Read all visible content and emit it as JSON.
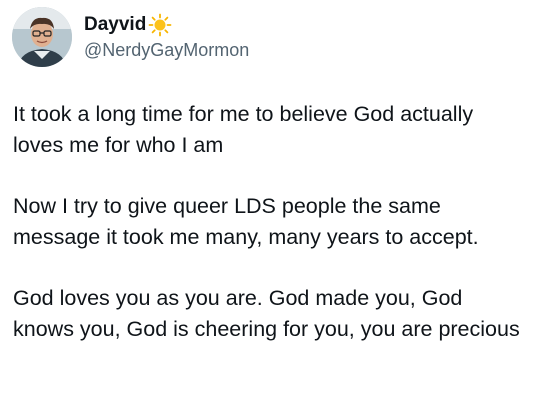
{
  "user": {
    "display_name": "Dayvid",
    "name_emoji": "sun-icon",
    "handle": "@NerdyGayMormon"
  },
  "tweet": {
    "paragraphs": [
      "It took a long time for me to believe God actually loves me for who I am",
      "Now I try to give queer LDS people the same message it took me many, many years to accept.",
      "God loves you as you are. God made you, God knows you, God is cheering for you, you are precious"
    ]
  },
  "colors": {
    "text": "#0f1419",
    "secondary": "#536471",
    "sun": "#f7b500"
  }
}
